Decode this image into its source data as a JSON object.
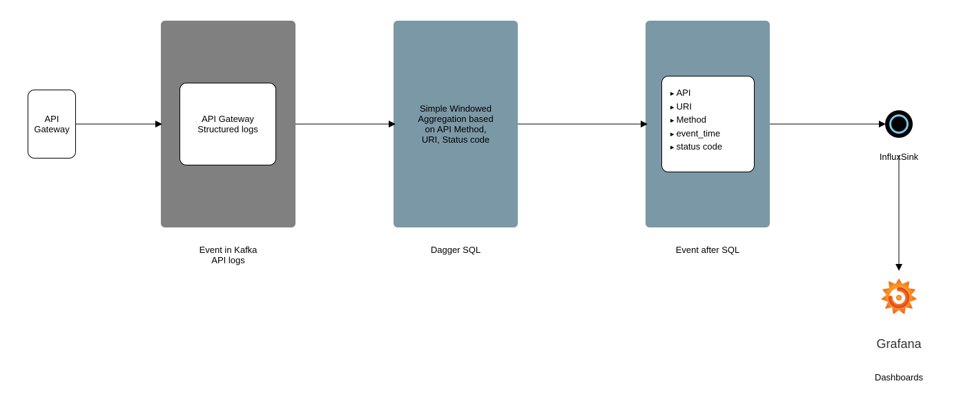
{
  "nodes": {
    "api_gateway": {
      "label": "API\nGateway"
    },
    "kafka": {
      "inner_label": "API Gateway\nStructured logs",
      "caption": "Event in Kafka\nAPI logs"
    },
    "dagger": {
      "label": "Simple Windowed\nAggregation based\non API Method,\nURI, Status code",
      "caption": "Dagger SQL"
    },
    "event_after": {
      "bullets": [
        "API",
        "URI",
        "Method",
        "event_time",
        "status code"
      ],
      "caption": "Event after SQL"
    },
    "influx": {
      "caption": "InfluxSink"
    },
    "grafana": {
      "label": "Grafana",
      "caption": "Dashboards"
    }
  },
  "colors": {
    "gray": "#808080",
    "blue": "#7B98A6",
    "grafana_orange": "#F7941E",
    "grafana_red": "#E33A2B",
    "grafana_yellow": "#FBB040"
  }
}
